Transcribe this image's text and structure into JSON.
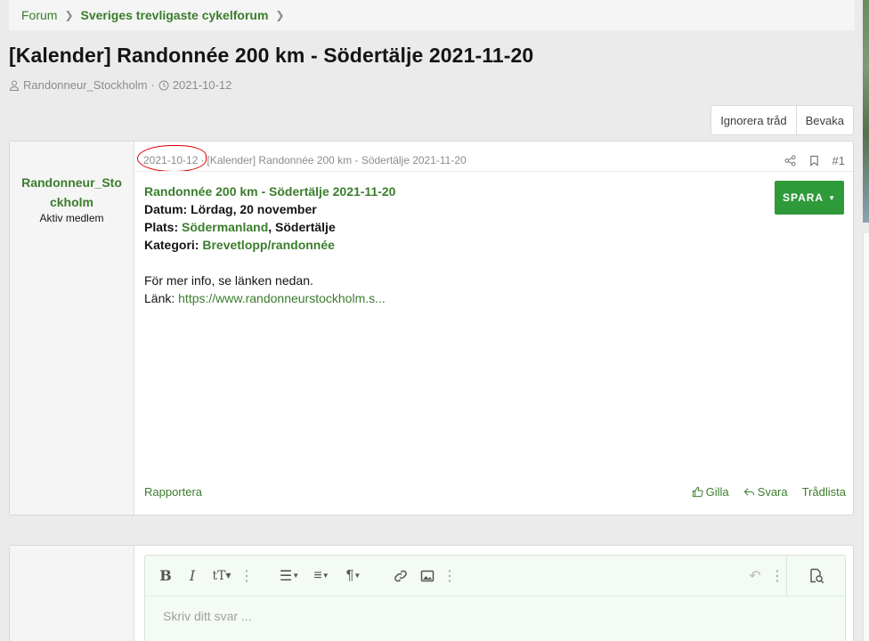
{
  "breadcrumb": {
    "items": [
      "Forum",
      "Sveriges trevligaste cykelforum"
    ]
  },
  "thread": {
    "title": "[Kalender] Randonnée 200 km - Södertälje 2021-11-20",
    "author": "Randonneur_Stockholm",
    "date": "2021-10-12",
    "buttons": {
      "ignore": "Ignorera tråd",
      "watch": "Bevaka"
    }
  },
  "post": {
    "username": "Randonneur_Stockholm",
    "user_title": "Aktiv medlem",
    "date": "2021-10-12",
    "separator": "·",
    "breadcrumb_title": "[Kalender] Randonnée 200 km - Södertälje 2021-11-20",
    "number": "#1",
    "event_title": "Randonnée 200 km - Södertälje 2021-11-20",
    "datum_label": "Datum:",
    "datum_value": "Lördag, 20 november",
    "plats_label": "Plats:",
    "plats_link": "Södermanland",
    "plats_rest": ", Södertälje",
    "kategori_label": "Kategori:",
    "kategori_link": "Brevetlopp/randonnée",
    "info": "För mer info, se länken nedan.",
    "link_label": "Länk:",
    "link": "https://www.randonneurstockholm.s...",
    "save_button": "SPARA",
    "report": "Rapportera",
    "like": "Gilla",
    "reply": "Svara",
    "threadlist": "Trådlista"
  },
  "reply_editor": {
    "placeholder": "Skriv ditt svar ..."
  },
  "colors": {
    "accent": "#3a7d2c",
    "save_button": "#2f9a3a",
    "annotation": "#e00000"
  }
}
